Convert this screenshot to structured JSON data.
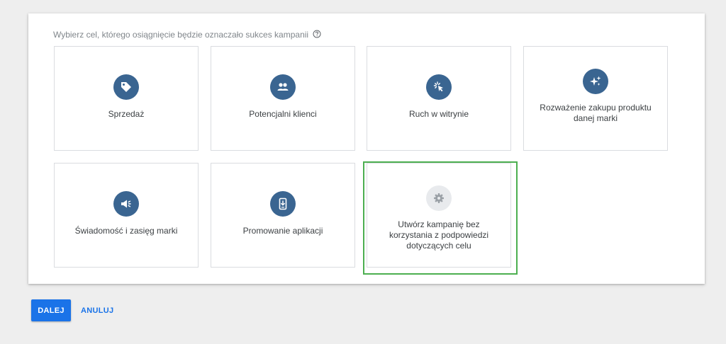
{
  "panel": {
    "heading": "Wybierz cel, którego osiągnięcie będzie oznaczało sukces kampanii",
    "help_icon": "help-circle-icon",
    "goals": [
      {
        "label": "Sprzedaż",
        "icon": "tag-icon"
      },
      {
        "label": "Potencjalni klienci",
        "icon": "people-icon"
      },
      {
        "label": "Ruch w witrynie",
        "icon": "cursor-click-icon"
      },
      {
        "label": "Rozważenie zakupu produktu danej marki",
        "icon": "sparkle-icon"
      },
      {
        "label": "Świadomość i zasięg marki",
        "icon": "megaphone-icon"
      },
      {
        "label": "Promowanie aplikacji",
        "icon": "phone-download-icon"
      },
      {
        "label": "Utwórz kampanię bez korzystania z podpowiedzi dotyczących celu",
        "icon": "gear-icon"
      }
    ]
  },
  "actions": {
    "next_label": "DALEJ",
    "cancel_label": "ANULUJ"
  },
  "colors": {
    "accent": "#1a73e8",
    "icon_bg": "#3a6591",
    "highlight": "#4caf50"
  }
}
